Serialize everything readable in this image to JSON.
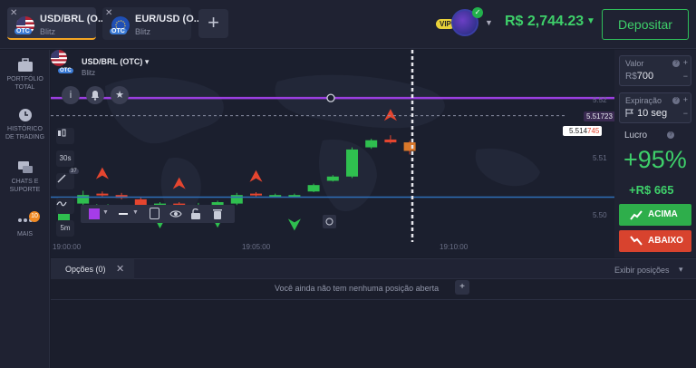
{
  "tabs": [
    {
      "title": "USD/BRL (O...",
      "subtitle": "Blitz",
      "badge": "OTC",
      "active": true
    },
    {
      "title": "EUR/USD (O...",
      "subtitle": "Blitz",
      "badge": "OTC",
      "active": false
    }
  ],
  "add_tab_label": "+",
  "account": {
    "vip_label": "VIP",
    "balance": "R$ 2,744.23",
    "deposit_label": "Depositar"
  },
  "sidebar": [
    {
      "label": "PORTFÓLIO TOTAL",
      "icon": "briefcase-icon"
    },
    {
      "label": "HISTÓRICO DE TRADING",
      "icon": "clock-icon"
    },
    {
      "label": "CHATS E SUPORTE",
      "icon": "chat-icon"
    },
    {
      "label": "MAIS",
      "icon": "more-icon",
      "badge": "10"
    }
  ],
  "asset": {
    "name": "USD/BRL (OTC)",
    "sub": "Blitz",
    "badge": "OTC"
  },
  "chart_tools": {
    "timeframe": "30s",
    "indicator_count": "37",
    "candle_size": "5m"
  },
  "chart_data": {
    "type": "candlestick",
    "y_ticks": [
      "5.52",
      "5.51",
      "5.50"
    ],
    "x_ticks": [
      "19:00:00",
      "19:05:00",
      "19:10:00"
    ],
    "ylim": [
      5.497,
      5.524
    ],
    "candles": [
      {
        "o": 5.5,
        "c": 5.501,
        "h": 5.5014,
        "l": 5.4997
      },
      {
        "o": 5.5024,
        "c": 5.5036,
        "h": 5.5042,
        "l": 5.5018
      },
      {
        "o": 5.5038,
        "c": 5.5036,
        "h": 5.5041,
        "l": 5.5034
      },
      {
        "o": 5.5036,
        "c": 5.5032,
        "h": 5.5039,
        "l": 5.503
      },
      {
        "o": 5.503,
        "c": 5.5018,
        "h": 5.5033,
        "l": 5.5016
      },
      {
        "o": 5.5024,
        "c": 5.5024,
        "h": 5.5026,
        "l": 5.5022
      },
      {
        "o": 5.5024,
        "c": 5.502,
        "h": 5.5026,
        "l": 5.5017
      },
      {
        "o": 5.5018,
        "c": 5.5022,
        "h": 5.5025,
        "l": 5.5014
      },
      {
        "o": 5.5018,
        "c": 5.5026,
        "h": 5.5028,
        "l": 5.5015
      },
      {
        "o": 5.5024,
        "c": 5.5036,
        "h": 5.5039,
        "l": 5.5022
      },
      {
        "o": 5.5038,
        "c": 5.5036,
        "h": 5.504,
        "l": 5.5034
      },
      {
        "o": 5.5036,
        "c": 5.5036,
        "h": 5.5038,
        "l": 5.5034
      },
      {
        "o": 5.5036,
        "c": 5.5036,
        "h": 5.5038,
        "l": 5.5034
      },
      {
        "o": 5.5041,
        "c": 5.505,
        "h": 5.5052,
        "l": 5.504
      },
      {
        "o": 5.5056,
        "c": 5.5062,
        "h": 5.5064,
        "l": 5.5055
      },
      {
        "o": 5.5062,
        "c": 5.51,
        "h": 5.5103,
        "l": 5.506
      },
      {
        "o": 5.5103,
        "c": 5.5113,
        "h": 5.5115,
        "l": 5.5101
      },
      {
        "o": 5.5114,
        "c": 5.511,
        "h": 5.512,
        "l": 5.5108
      },
      {
        "o": 5.511,
        "c": 5.5098,
        "h": 5.5112,
        "l": 5.5093
      }
    ],
    "up_arrows": [
      {
        "i": 2,
        "p": 5.5066
      },
      {
        "i": 6,
        "p": 5.5052
      },
      {
        "i": 10,
        "p": 5.5062
      },
      {
        "i": 17,
        "p": 5.5148
      }
    ],
    "down_arrows": [
      {
        "i": 2,
        "p": 5.5016
      },
      {
        "i": 4,
        "p": 5.5006
      },
      {
        "i": 5,
        "p": 5.4998
      },
      {
        "i": 8,
        "p": 5.4999
      },
      {
        "i": 12,
        "p": 5.4995
      }
    ],
    "purple_line": 5.51723,
    "blue_line": 5.5033,
    "dashed_line": 5.514745,
    "purple_price": "5.51723",
    "current_price_main": "5.514",
    "current_price_accent": "745"
  },
  "panel": {
    "value_label": "Valor",
    "value_currency": "R$",
    "value": "700",
    "expiry_label": "Expiração",
    "expiry": "10 seg",
    "profit_label": "Lucro",
    "profit_pct": "+95%",
    "profit_amount": "+R$ 665",
    "up_label": "ACIMA",
    "down_label": "ABAIXO",
    "up_color": "#2eae4b",
    "down_color": "#d8432e"
  },
  "bottom": {
    "tab_label": "Opções (0)",
    "show_positions": "Exibir posições",
    "empty_message": "Você ainda não tem nenhuma posição aberta"
  }
}
